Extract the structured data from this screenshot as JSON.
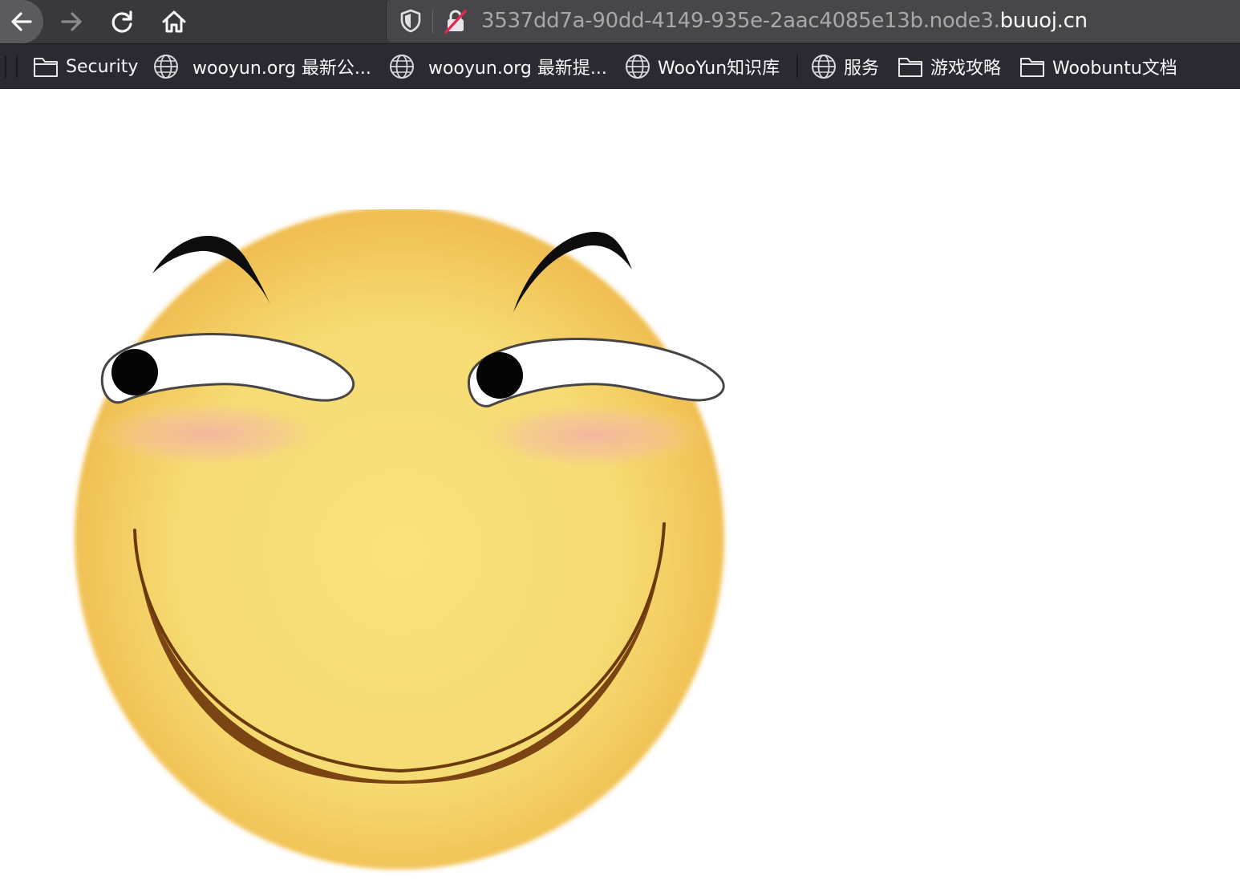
{
  "nav": {
    "back_icon": "arrow-left-icon",
    "forward_icon": "arrow-right-icon",
    "reload_icon": "reload-icon",
    "home_icon": "home-icon"
  },
  "url_bar": {
    "subdomain": "3537dd7a-90dd-4149-935e-2aac4085e13b.node3.",
    "domain": "buuoj.cn",
    "security_icon": "insecure-lock-icon",
    "tracking_icon": "shield-icon"
  },
  "bookmarks": [
    {
      "label": "Security",
      "icon": "folder-icon"
    },
    {
      "label": "wooyun.org 最新公...",
      "icon": "globe-icon"
    },
    {
      "label": "wooyun.org 最新提...",
      "icon": "globe-icon"
    },
    {
      "label": "WooYun知识库",
      "icon": "globe-icon"
    },
    {
      "label": "服务",
      "icon": "globe-icon"
    },
    {
      "label": "游戏攻略",
      "icon": "folder-icon"
    },
    {
      "label": "Woobuntu文档",
      "icon": "folder-icon"
    }
  ],
  "page": {
    "image": "smirking-smiley-face",
    "colors": {
      "face_light": "#f8e27a",
      "face_dark": "#f0b442",
      "blush": "#f3b4a0",
      "mouth": "#7a4512"
    }
  }
}
